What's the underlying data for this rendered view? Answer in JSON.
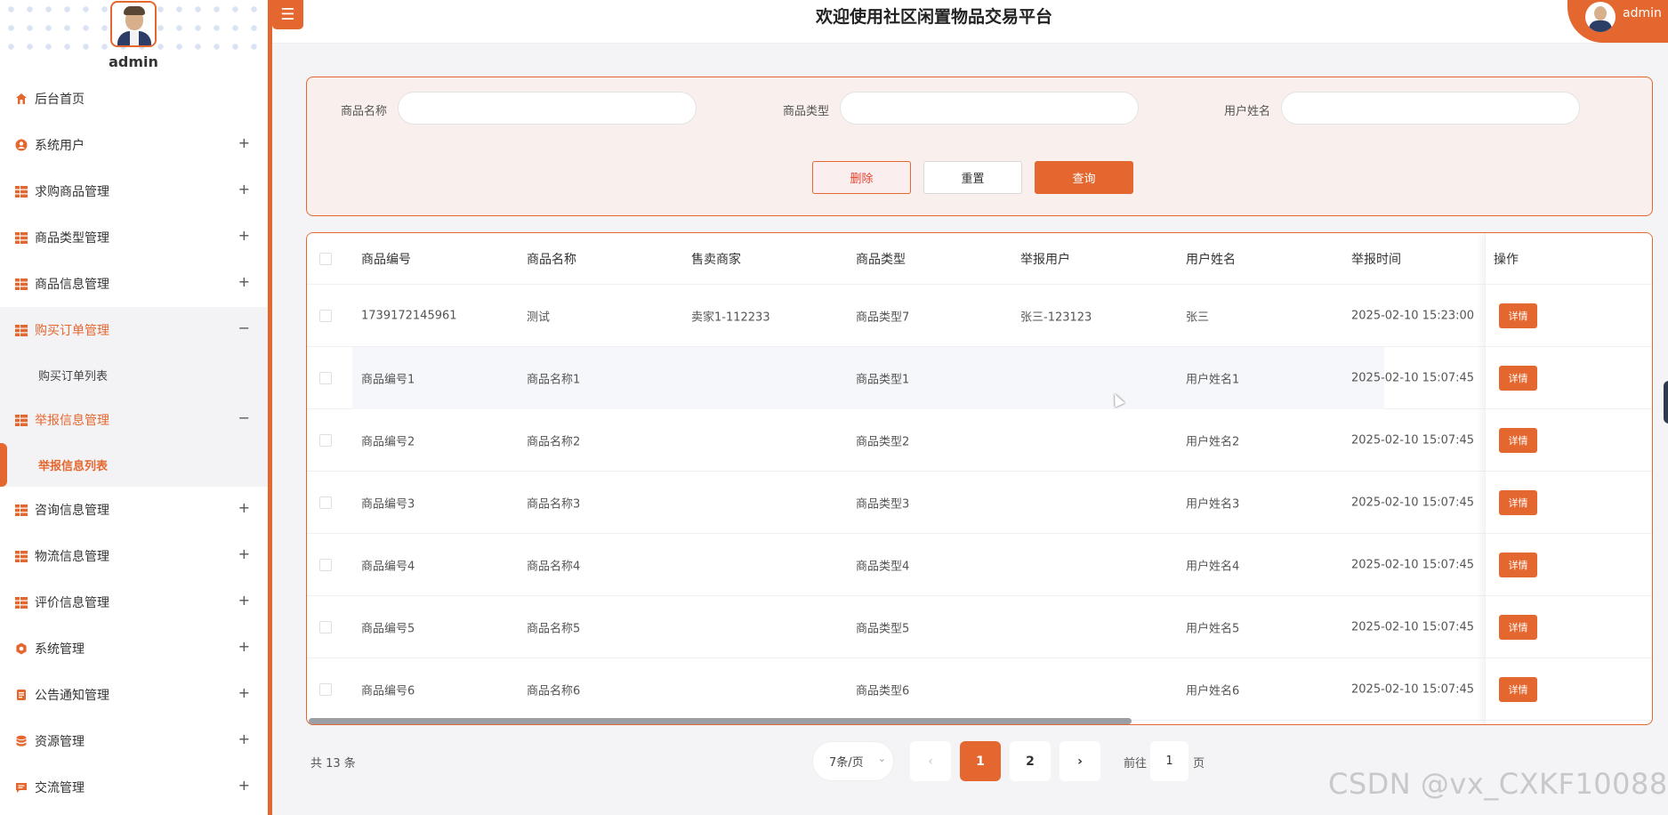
{
  "colors": {
    "accent": "#e4672f",
    "danger_text": "#e4432f",
    "page_bg": "#f4f4f6"
  },
  "sidebar": {
    "user_name": "admin",
    "items": [
      {
        "label": "后台首页",
        "icon": "home-icon",
        "toggle": ""
      },
      {
        "label": "系统用户",
        "icon": "user-icon",
        "toggle": "+"
      },
      {
        "label": "求购商品管理",
        "icon": "grid-icon",
        "toggle": "+"
      },
      {
        "label": "商品类型管理",
        "icon": "grid-icon",
        "toggle": "+"
      },
      {
        "label": "商品信息管理",
        "icon": "grid-icon",
        "toggle": "+"
      },
      {
        "label": "购买订单管理",
        "icon": "grid-icon",
        "toggle": "−",
        "sub": "购买订单列表"
      },
      {
        "label": "举报信息管理",
        "icon": "grid-icon",
        "toggle": "−",
        "sub": "举报信息列表"
      },
      {
        "label": "咨询信息管理",
        "icon": "grid-icon",
        "toggle": "+"
      },
      {
        "label": "物流信息管理",
        "icon": "grid-icon",
        "toggle": "+"
      },
      {
        "label": "评价信息管理",
        "icon": "grid-icon",
        "toggle": "+"
      },
      {
        "label": "系统管理",
        "icon": "gear-icon",
        "toggle": "+"
      },
      {
        "label": "公告通知管理",
        "icon": "notice-icon",
        "toggle": "+"
      },
      {
        "label": "资源管理",
        "icon": "database-icon",
        "toggle": "+"
      },
      {
        "label": "交流管理",
        "icon": "chat-icon",
        "toggle": "+"
      }
    ]
  },
  "header": {
    "menu_icon": "☰",
    "title": "欢迎使用社区闲置物品交易平台",
    "user_name": "admin"
  },
  "search": {
    "fields": [
      {
        "label": "商品名称",
        "value": ""
      },
      {
        "label": "商品类型",
        "value": ""
      },
      {
        "label": "用户姓名",
        "value": ""
      }
    ],
    "delete_label": "删除",
    "reset_label": "重置",
    "query_label": "查询"
  },
  "table": {
    "columns": [
      "商品编号",
      "商品名称",
      "售卖商家",
      "商品类型",
      "举报用户",
      "用户姓名",
      "举报时间",
      "操作"
    ],
    "action_label": "详情",
    "rows": [
      [
        "1739172145961",
        "测试",
        "卖家1-112233",
        "商品类型7",
        "张三-123123",
        "张三",
        "2025-02-10 15:23:00"
      ],
      [
        "商品编号1",
        "商品名称1",
        "",
        "商品类型1",
        "",
        "用户姓名1",
        "2025-02-10 15:07:45"
      ],
      [
        "商品编号2",
        "商品名称2",
        "",
        "商品类型2",
        "",
        "用户姓名2",
        "2025-02-10 15:07:45"
      ],
      [
        "商品编号3",
        "商品名称3",
        "",
        "商品类型3",
        "",
        "用户姓名3",
        "2025-02-10 15:07:45"
      ],
      [
        "商品编号4",
        "商品名称4",
        "",
        "商品类型4",
        "",
        "用户姓名4",
        "2025-02-10 15:07:45"
      ],
      [
        "商品编号5",
        "商品名称5",
        "",
        "商品类型5",
        "",
        "用户姓名5",
        "2025-02-10 15:07:45"
      ],
      [
        "商品编号6",
        "商品名称6",
        "",
        "商品类型6",
        "",
        "用户姓名6",
        "2025-02-10 15:07:45"
      ]
    ]
  },
  "pagination": {
    "total": "共 13 条",
    "page_size": "7条/页",
    "prev": "‹",
    "pages": [
      "1",
      "2"
    ],
    "next": "›",
    "goto_prefix": "前往",
    "goto_value": "1",
    "goto_suffix": "页"
  },
  "watermark": "CSDN @vx_CXKF10088"
}
